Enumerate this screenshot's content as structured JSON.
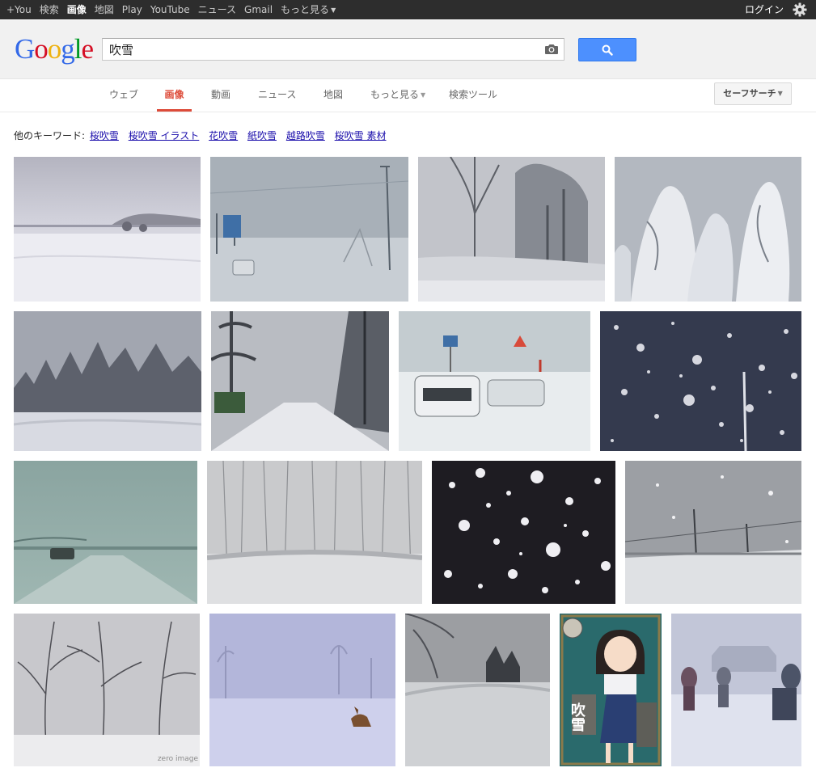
{
  "topnav": {
    "items": [
      {
        "label": "+You",
        "active": false
      },
      {
        "label": "検索",
        "active": false
      },
      {
        "label": "画像",
        "active": true
      },
      {
        "label": "地図",
        "active": false
      },
      {
        "label": "Play",
        "active": false
      },
      {
        "label": "YouTube",
        "active": false
      },
      {
        "label": "ニュース",
        "active": false
      },
      {
        "label": "Gmail",
        "active": false
      },
      {
        "label": "もっと見る",
        "active": false
      }
    ],
    "login_label": "ログイン"
  },
  "header": {
    "logo_letters": [
      "G",
      "o",
      "o",
      "g",
      "l",
      "e"
    ],
    "search_value": "吹雪"
  },
  "tabs": {
    "items": [
      "ウェブ",
      "画像",
      "動画",
      "ニュース",
      "地図",
      "もっと見る",
      "検索ツール"
    ],
    "active": "画像",
    "safesearch_label": "セーフサーチ"
  },
  "related": {
    "prefix": "他のキーワード:",
    "links": [
      "桜吹雪",
      "桜吹雪 イラスト",
      "花吹雪",
      "紙吹雪",
      "越路吹雪",
      "桜吹雪 素材"
    ]
  },
  "results": {
    "watermark": "zero image",
    "card_text": "吹雪"
  },
  "colors": {
    "google_blue": "#3369e8",
    "google_red": "#d50f25",
    "google_yellow": "#eeb211",
    "google_green": "#009925",
    "accent_red": "#dd4b39",
    "button_blue": "#4d90fe"
  }
}
